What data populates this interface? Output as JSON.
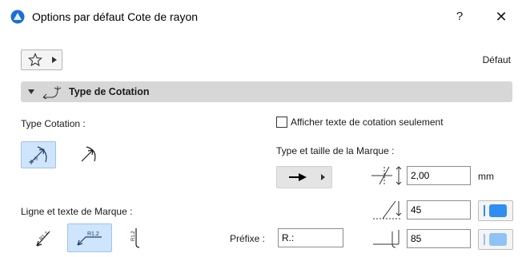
{
  "window": {
    "title": "Options par défaut Cote de rayon",
    "help_label": "?",
    "close_label": "✕",
    "icon": "archicad-app-icon"
  },
  "toolbar": {
    "favorites_icon": "star-icon",
    "default_label": "Défaut"
  },
  "section": {
    "title": "Type de Cotation",
    "icon": "radius-dimension-icon",
    "expanded": true
  },
  "dimension_type": {
    "label": "Type Cotation :",
    "options": [
      "radius-with-center-icon",
      "radius-arrow-icon"
    ],
    "selected_index": 0
  },
  "text_only": {
    "label": "Afficher texte de cotation seulement",
    "checked": false
  },
  "marker": {
    "label": "Type et taille de la Marque :",
    "size_value": "2,00",
    "size_unit": "mm",
    "angle_value": "45",
    "pen_value": "85"
  },
  "marker_line": {
    "label": "Ligne et texte de Marque :",
    "options": [
      "R1.2",
      "R1.2",
      "R1.2"
    ],
    "selected_index": 1,
    "prefix_label": "Préfixe :",
    "prefix_value": "R.:"
  },
  "colors": {
    "accent": "#2f8ef0",
    "accent_light": "#8fc3f6",
    "section_bg": "#d7d7d7",
    "selected_bg": "#cfe5fb"
  }
}
